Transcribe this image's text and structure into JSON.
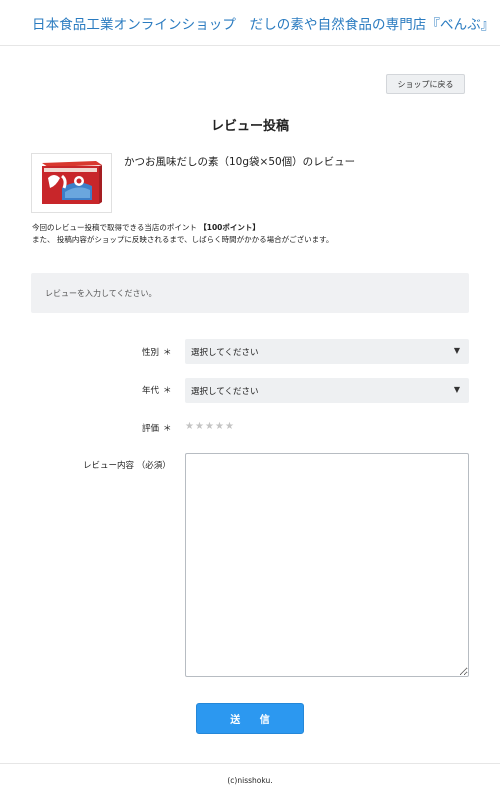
{
  "header": {
    "site_title": "日本食品工業オンラインショップ　だしの素や自然食品の専門店『べんぶ』"
  },
  "toolbar": {
    "back_label": "ショップに戻る"
  },
  "page": {
    "title": "レビュー投稿"
  },
  "product": {
    "image_name": "product-package-image",
    "name": "かつお風味だしの素（10g袋×50個）のレビュー"
  },
  "points": {
    "text": "今回のレビュー投稿で取得できる当店のポイント",
    "value": "【100ポイント】",
    "note": "また、 投稿内容がショップに反映されるまで、しばらく時間がかかる場合がございます。"
  },
  "banner": {
    "text": "レビューを入力してください。"
  },
  "form": {
    "gender": {
      "label": "性別",
      "required_mark": "＊",
      "value": "選択してください"
    },
    "age": {
      "label": "年代",
      "required_mark": "＊",
      "value": "選択してください"
    },
    "rating": {
      "label": "評価",
      "required_mark": "＊",
      "stars_total": 5,
      "stars_selected": 0,
      "star_glyph": "★"
    },
    "review": {
      "label": "レビュー内容 （必須）",
      "value": ""
    },
    "dropdown_glyph": "▼",
    "submit_label": "送 信"
  },
  "footer": {
    "copyright": "(c)nisshoku."
  },
  "colors": {
    "link": "#2a7bc0",
    "submit": "#2c98f0",
    "input_bg": "#eef0f2",
    "star_empty": "#c4c4c4"
  }
}
